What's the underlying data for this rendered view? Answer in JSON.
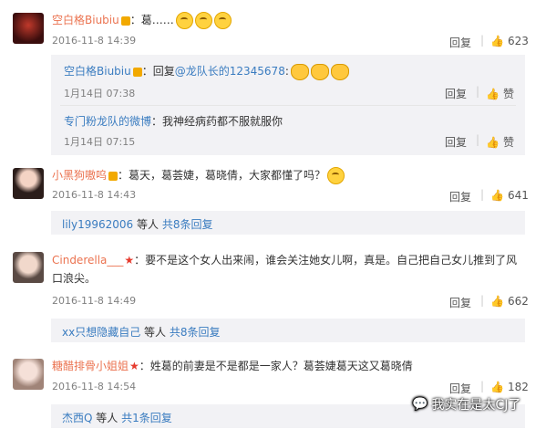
{
  "comments": [
    {
      "user": "空白格Biubiu",
      "text": "：葛……",
      "time": "2016-11-8 14:39",
      "reply_label": "回复",
      "likes": "623",
      "subreplies": [
        {
          "user": "空白格Biubiu",
          "text": "：回复",
          "mention": "@龙队长的12345678",
          "text2": ":",
          "time": "1月14日 07:38",
          "reply_label": "回复",
          "likes": "赞"
        },
        {
          "user": "专门粉龙队的微博",
          "text": "：我神经病药都不服就服你",
          "time": "1月14日 07:15",
          "reply_label": "回复",
          "likes": "赞"
        }
      ]
    },
    {
      "user": "小黑狗嗷呜",
      "text": "：葛天，葛荟婕，葛晓倩，大家都懂了吗？",
      "time": "2016-11-8 14:43",
      "reply_label": "回复",
      "likes": "641",
      "more_user": "lily19962006",
      "more_mid": " 等人 ",
      "more_link": "共8条回复"
    },
    {
      "user": "Cinderella___",
      "text": "：要不是这个女人出来闹，谁会关注她女儿啊，真是。自己把自己女儿推到了风",
      "text_line2": "口浪尖。",
      "time": "2016-11-8 14:49",
      "reply_label": "回复",
      "likes": "662",
      "more_user": "xx只想隐藏自己",
      "more_mid": " 等人 ",
      "more_link": "共8条回复"
    },
    {
      "user": "糖醋排骨小姐姐",
      "text": "：姓葛的前妻是不是都是一家人？葛荟婕葛天这又葛晓倩",
      "time": "2016-11-8 14:54",
      "reply_label": "回复",
      "likes": "182",
      "more_user": "杰西Q",
      "more_mid": " 等人 ",
      "more_link": "共1条回复"
    }
  ],
  "watermark": "我实在是太CJ了",
  "colors": {
    "name": "#eb7350",
    "link": "#3a7cc0"
  }
}
